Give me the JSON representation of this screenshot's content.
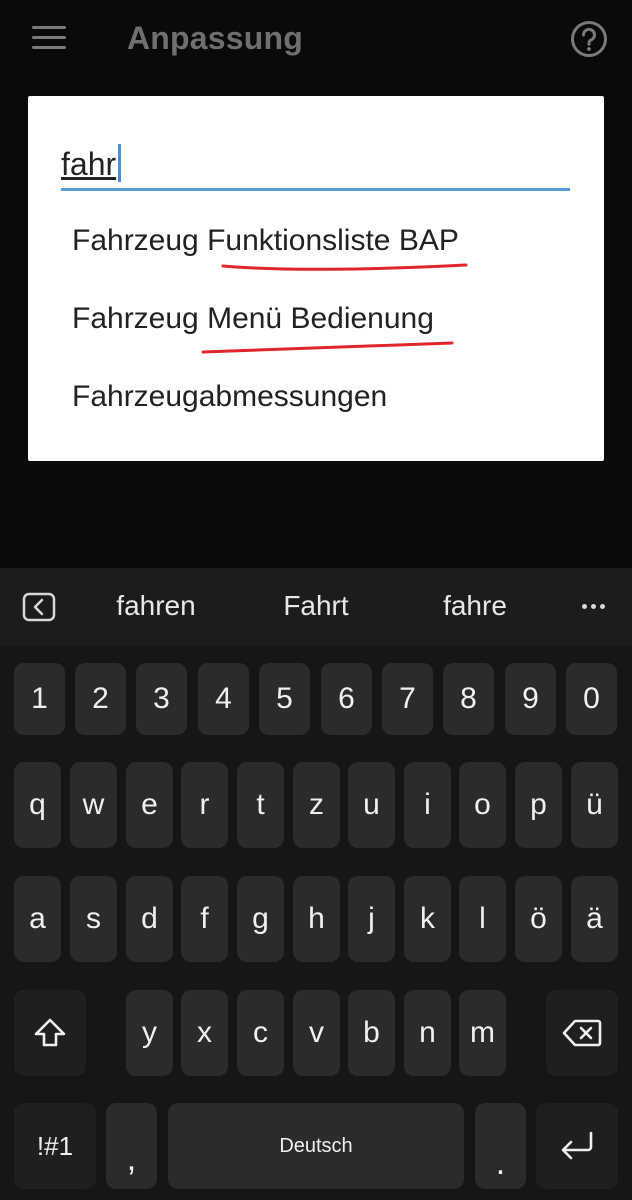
{
  "app_bar": {
    "title": "Anpassung",
    "menu_icon": "hamburger-menu-icon",
    "help_icon": "help-circle-icon"
  },
  "search_dialog": {
    "query": "fahr",
    "results": [
      {
        "label": "Fahrzeug Funktionsliste BAP",
        "annotated": true
      },
      {
        "label": "Fahrzeug Menü Bedienung",
        "annotated": true
      },
      {
        "label": "Fahrzeugabmessungen",
        "annotated": false
      }
    ],
    "annotation_color": "#e0262c",
    "underline_color": "#5b9bd9"
  },
  "keyboard": {
    "suggestions": [
      "fahren",
      "Fahrt",
      "fahre"
    ],
    "back_icon": "keyboard-collapse-icon",
    "more_icon": "more-horizontal-icon",
    "number_row": [
      "1",
      "2",
      "3",
      "4",
      "5",
      "6",
      "7",
      "8",
      "9",
      "0"
    ],
    "row1": [
      "q",
      "w",
      "e",
      "r",
      "t",
      "z",
      "u",
      "i",
      "o",
      "p",
      "ü"
    ],
    "row2": [
      "a",
      "s",
      "d",
      "f",
      "g",
      "h",
      "j",
      "k",
      "l",
      "ö",
      "ä"
    ],
    "row3": [
      "y",
      "x",
      "c",
      "v",
      "b",
      "n",
      "m"
    ],
    "symbols_label": "!#1",
    "comma_label": ",",
    "space_label": "Deutsch",
    "period_label": ".",
    "shift_icon": "shift-arrow-icon",
    "backspace_icon": "backspace-icon",
    "enter_icon": "enter-return-icon"
  }
}
